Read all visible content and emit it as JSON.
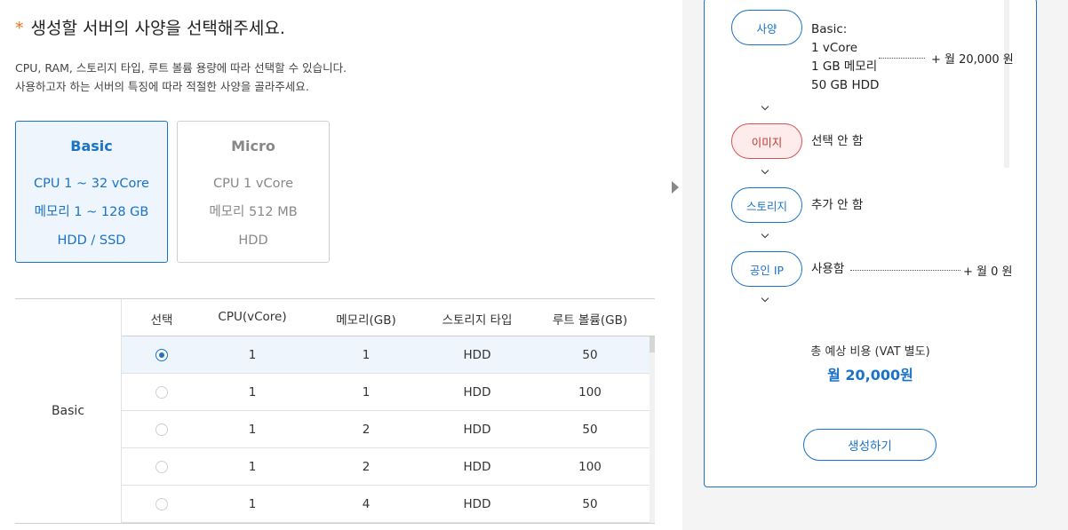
{
  "heading": {
    "star": "*",
    "text": "생성할 서버의 사양을 선택해주세요."
  },
  "description": {
    "line1": "CPU, RAM, 스토리지 타입, 루트 볼륨 용량에 따라 선택할 수 있습니다.",
    "line2": "사용하고자 하는 서버의 특징에 따라 적절한 사양을 골라주세요."
  },
  "cards": [
    {
      "title": "Basic",
      "lines": [
        "CPU 1 ~ 32 vCore",
        "메모리 1 ~ 128 GB",
        "HDD / SSD"
      ],
      "selected": true
    },
    {
      "title": "Micro",
      "lines": [
        "CPU 1 vCore",
        "메모리 512 MB",
        "HDD"
      ],
      "selected": false
    }
  ],
  "table": {
    "group": "Basic",
    "headers": [
      "선택",
      "CPU(vCore)",
      "메모리(GB)",
      "스토리지 타입",
      "루트 볼륨(GB)"
    ],
    "rows": [
      {
        "selected": true,
        "cpu": "1",
        "memory": "1",
        "storage": "HDD",
        "root": "50"
      },
      {
        "selected": false,
        "cpu": "1",
        "memory": "1",
        "storage": "HDD",
        "root": "100"
      },
      {
        "selected": false,
        "cpu": "1",
        "memory": "2",
        "storage": "HDD",
        "root": "50"
      },
      {
        "selected": false,
        "cpu": "1",
        "memory": "2",
        "storage": "HDD",
        "root": "100"
      },
      {
        "selected": false,
        "cpu": "1",
        "memory": "4",
        "storage": "HDD",
        "root": "50"
      }
    ]
  },
  "summary": {
    "spec": {
      "label": "사양",
      "lines": [
        "Basic:",
        "1 vCore",
        "1 GB 메모리",
        "50 GB HDD"
      ],
      "price": "+ 월 20,000 원"
    },
    "image": {
      "label": "이미지",
      "value": "선택 안 함"
    },
    "storage": {
      "label": "스토리지",
      "value": "추가 안 함"
    },
    "public_ip": {
      "label": "공인 IP",
      "value": "사용함",
      "price": "+ 월 0 원"
    },
    "total_label": "총 예상 비용 (VAT 별도)",
    "total_value": "월 20,000원",
    "create_button": "생성하기"
  },
  "colors": {
    "accent": "#1a73c9",
    "warning": "#e8761e",
    "error": "#c0392b"
  }
}
